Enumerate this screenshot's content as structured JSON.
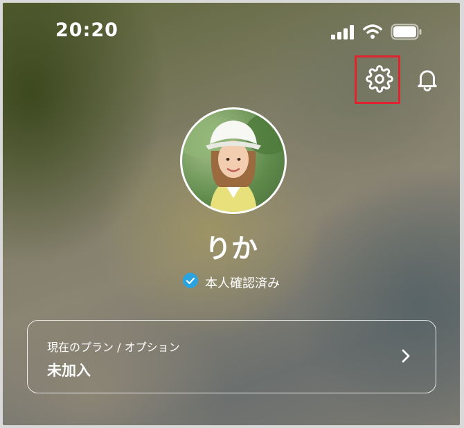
{
  "status_bar": {
    "time": "20:20",
    "icons": [
      "cellular-signal-icon",
      "wifi-icon",
      "battery-icon"
    ]
  },
  "header": {
    "settings_icon": "gear-icon",
    "notifications_icon": "bell-icon",
    "highlight_color": "#e0242e"
  },
  "profile": {
    "name": "りか",
    "verified_label": "本人確認済み",
    "verified_icon": "check-badge-icon",
    "verified_color": "#2aa3df"
  },
  "plan": {
    "label": "現在のプラン / オプション",
    "value": "未加入",
    "chevron_icon": "chevron-right-icon"
  }
}
